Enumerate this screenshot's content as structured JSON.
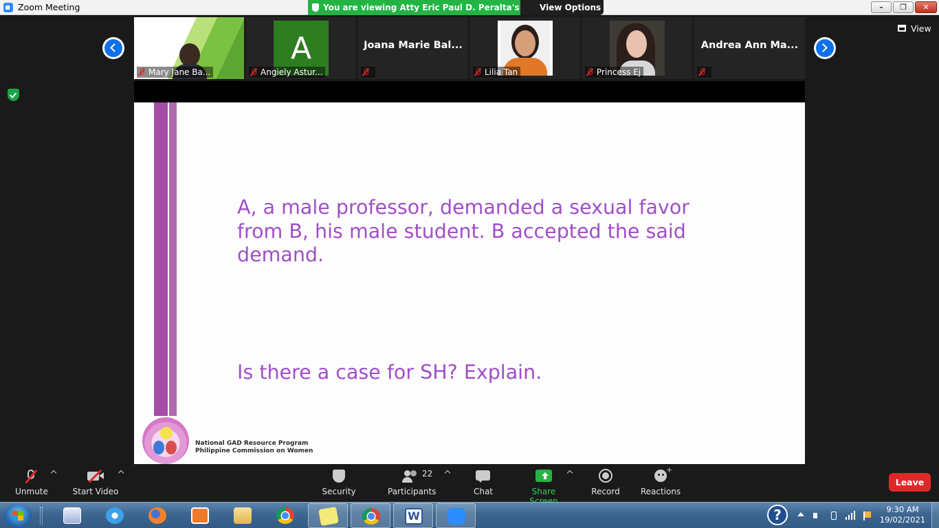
{
  "window": {
    "title": "Zoom Meeting",
    "share_banner": "You are viewing Atty Eric Paul D. Peralta's screen",
    "view_options": "View Options"
  },
  "gallery": {
    "view_label": "View",
    "participants": [
      {
        "name": "Mary Jane Ba...",
        "muted": true,
        "display": "photo"
      },
      {
        "name": "Angiely Astur...",
        "muted": true,
        "display": "avatar",
        "initial": "A"
      },
      {
        "name": "Joana Marie Bal...",
        "muted": true,
        "display": "name-only"
      },
      {
        "name": "Lilia Tan",
        "muted": true,
        "display": "photo"
      },
      {
        "name": "Princess Ej",
        "muted": true,
        "display": "photo"
      },
      {
        "name": "Andrea Ann Ma...",
        "muted": true,
        "display": "name-only"
      }
    ]
  },
  "slide": {
    "body": "A, a male professor, demanded a sexual favor from B, his male student. B accepted the said demand.",
    "question": "Is there a case for SH? Explain.",
    "org_line1": "National GAD Resource Program",
    "org_line2": "Philippine Commission on Women"
  },
  "toolbar": {
    "unmute": "Unmute",
    "start_video": "Start Video",
    "security": "Security",
    "participants": "Participants",
    "participants_count": "22",
    "chat": "Chat",
    "share_screen": "Share Screen",
    "record": "Record",
    "reactions": "Reactions",
    "leave": "Leave"
  },
  "taskbar": {
    "time": "9:30 AM",
    "date": "19/02/2021",
    "help": "?"
  },
  "colors": {
    "zoom_blue": "#0e71eb",
    "banner_green": "#23b443",
    "slide_text": "#a04fc8",
    "leave_red": "#e02828"
  }
}
